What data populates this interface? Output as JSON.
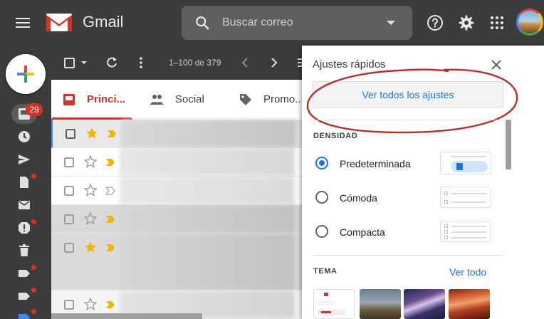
{
  "header": {
    "app_name": "Gmail",
    "search_placeholder": "Buscar correo",
    "icons": [
      "menu-icon",
      "search-icon",
      "help-icon",
      "gear-icon",
      "apps-icon"
    ]
  },
  "rail": {
    "inbox_badge": "29",
    "icons": [
      "inbox-icon",
      "clock-icon",
      "send-icon",
      "draft-icon",
      "mail-icon",
      "spam-icon",
      "trash-icon",
      "label-icon",
      "label-icon",
      "label-icon"
    ]
  },
  "toolbar": {
    "count": "1–100 de 379"
  },
  "tabs": [
    {
      "label": "Princi..."
    },
    {
      "label": "Social"
    },
    {
      "label": "Promo..."
    }
  ],
  "rows": [
    {
      "starred": true,
      "important": true,
      "selected": true
    },
    {
      "starred": false,
      "important": true
    },
    {
      "starred": false,
      "important": false
    },
    {
      "starred": false,
      "important": true
    },
    {
      "starred": true,
      "important": true
    }
  ],
  "quick_settings": {
    "title": "Ajustes rápidos",
    "all_settings_label": "Ver todos los ajustes",
    "density_label": "DENSIDAD",
    "density_options": [
      {
        "label": "Predeterminada",
        "selected": true
      },
      {
        "label": "Cómoda",
        "selected": false
      },
      {
        "label": "Compacta",
        "selected": false
      }
    ],
    "theme_label": "TEMA",
    "theme_view_all": "Ver todo"
  },
  "colors": {
    "accent_blue": "#1a73e8",
    "gmail_red": "#d93025",
    "header_bg": "#3c3c3c",
    "annotation_red": "#c62828"
  }
}
